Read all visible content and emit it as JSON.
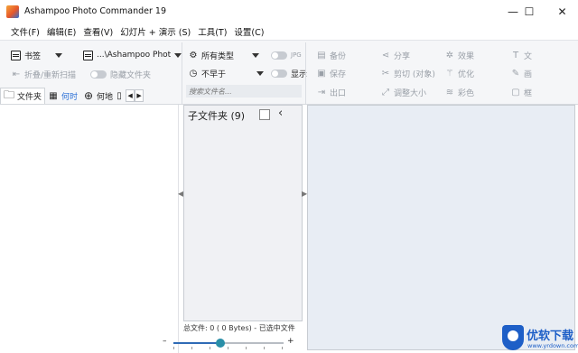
{
  "window": {
    "title": "Ashampoo Photo Commander 19",
    "minimize": "—",
    "maximize": "☐",
    "close": "✕"
  },
  "menu": [
    "文件(F)",
    "编辑(E)",
    "查看(V)",
    "幻灯片 + 演示 (S)",
    "工具(T)",
    "设置(C)"
  ],
  "toolbar": {
    "bookmarks": "书签",
    "path": "...\\Ashampoo Phot",
    "collapse_rescan": "折叠/重新扫描",
    "hide_folder": "隐藏文件夹",
    "all_types": "所有类型",
    "not_earlier": "不早于",
    "jpg": "JPG",
    "show": "显示",
    "search_placeholder": "搜索文件名...",
    "backup": "备份",
    "save": "保存",
    "export": "出口",
    "share": "分享",
    "cut_object": "剪切 (对象)",
    "resize": "调整大小",
    "effects": "效果",
    "optimize": "优化",
    "color": "彩色",
    "text_cut": "文",
    "draw_cut": "画",
    "frame_cut": "框"
  },
  "left_tabs": {
    "folder": "文件夹",
    "when": "何时",
    "where": "何地"
  },
  "middle": {
    "header": "子文件夹",
    "count": "(9)"
  },
  "status": {
    "text": "总文件: 0 (    0 Bytes) - 已选中文件"
  },
  "zoom": {
    "minus": "–",
    "plus": "+",
    "level_fraction": 0.43
  },
  "watermark": {
    "text": "优软下载",
    "sub": "www.yrdown.com"
  },
  "colors": {
    "accent": "#2a6fd6",
    "slider": "#2a8fa8",
    "preview_bg": "#e8edf4"
  }
}
